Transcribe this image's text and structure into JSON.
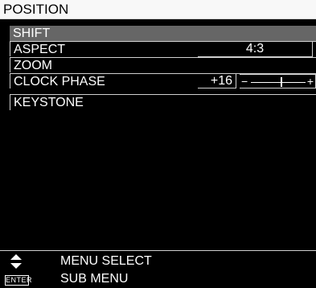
{
  "title": "POSITION",
  "menu": {
    "items": [
      {
        "label": "SHIFT"
      },
      {
        "label": "ASPECT",
        "value": "4:3"
      },
      {
        "label": "ZOOM"
      },
      {
        "label": "CLOCK PHASE",
        "value": "+16",
        "slider": {
          "min_symbol": "−",
          "max_symbol": "+",
          "level": 0.55
        }
      },
      {
        "label": "KEYSTONE"
      }
    ]
  },
  "footer": {
    "select_icon": "up-down-arrows-icon",
    "select_label": "MENU SELECT",
    "enter_badge": "ENTER",
    "enter_label": "SUB MENU"
  }
}
